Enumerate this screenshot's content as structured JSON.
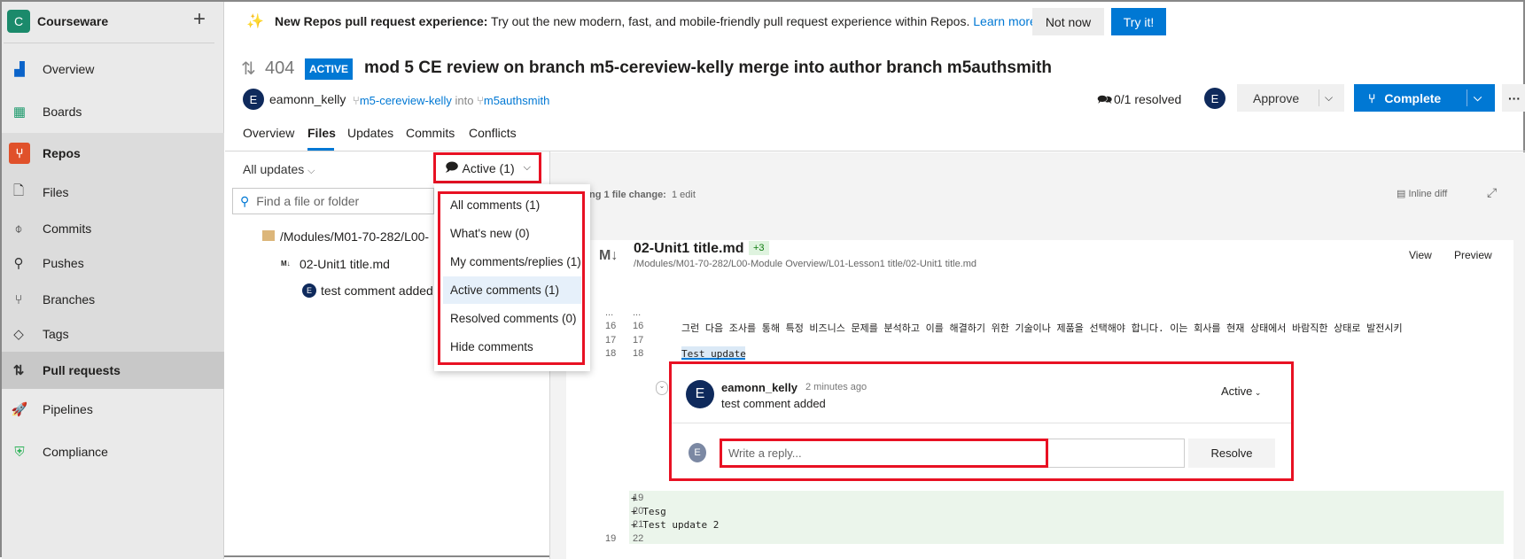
{
  "sidebar": {
    "org_initial": "C",
    "org": "Courseware",
    "add": "+",
    "items": [
      {
        "label": "Overview",
        "icon": "overview-icon"
      },
      {
        "label": "Boards",
        "icon": "boards-icon"
      },
      {
        "label": "Repos",
        "icon": "repos-icon"
      },
      {
        "label": "Files",
        "icon": "file-code-icon"
      },
      {
        "label": "Commits",
        "icon": "commit-icon"
      },
      {
        "label": "Pushes",
        "icon": "push-icon"
      },
      {
        "label": "Branches",
        "icon": "branch-icon"
      },
      {
        "label": "Tags",
        "icon": "tag-icon"
      },
      {
        "label": "Pull requests",
        "icon": "pull-request-icon"
      },
      {
        "label": "Pipelines",
        "icon": "pipelines-icon"
      },
      {
        "label": "Compliance",
        "icon": "compliance-icon"
      }
    ],
    "selected": "Pull requests"
  },
  "banner": {
    "bold": "New Repos pull request experience:",
    "text": "Try out the new modern, fast, and mobile-friendly pull request experience within Repos.",
    "link": "Learn more",
    "not_now": "Not now",
    "try": "Try it!"
  },
  "pr": {
    "id": "404",
    "status": "ACTIVE",
    "title": "mod 5 CE review on branch m5-cereview-kelly merge into author branch m5authsmith",
    "author_initial": "E",
    "author": "eamonn_kelly",
    "source": "m5-cereview-kelly",
    "into": "into",
    "target": "m5authsmith",
    "resolved": "0/1 resolved",
    "reviewer_initial": "E",
    "approve": "Approve",
    "complete": "Complete",
    "more": "···"
  },
  "tabs": [
    "Overview",
    "Files",
    "Updates",
    "Commits",
    "Conflicts"
  ],
  "active_tab": "Files",
  "files": {
    "updates": "All updates",
    "filter": "Active (1)",
    "search_placeholder": "Find a file or folder",
    "folder": "/Modules/M01-70-282/L00-",
    "file": "02-Unit1 title.md",
    "comment": "test comment added",
    "comment_initial": "E",
    "menu": [
      "All comments (1)",
      "What's new (0)",
      "My comments/replies (1)",
      "Active comments (1)",
      "Resolved comments (0)",
      "Hide comments"
    ],
    "menu_selected": "Active comments (1)"
  },
  "diff": {
    "summary_label": "ing 1 file change:",
    "summary_value": "1 edit",
    "inline": "Inline diff",
    "file_icon": "M↓",
    "file_name": "02-Unit1 title.md",
    "badge": "+3",
    "path": "/Modules/M01-70-282/L00-Module Overview/L01-Lesson1 title/02-Unit1 title.md",
    "view": "View",
    "preview": "Preview",
    "lines": [
      {
        "l": "...",
        "r": "...",
        "t": ""
      },
      {
        "l": "16",
        "r": "16",
        "t": "그런 다음 조사를 통해 특정 비즈니스 문제를 분석하고 이를 해결하기 위한 기술이나 제품을 선택해야 합니다. 이는 회사를 현재 상태에서 바람직한 상태로 발전시키"
      },
      {
        "l": "17",
        "r": "17",
        "t": ""
      },
      {
        "l": "18",
        "r": "18",
        "t": "Test update"
      }
    ],
    "added": [
      {
        "l": "",
        "r": "19",
        "t": "+"
      },
      {
        "l": "",
        "r": "20",
        "t": "+ Tesg"
      },
      {
        "l": "",
        "r": "21",
        "t": "+ Test update 2"
      }
    ],
    "last": {
      "l": "19",
      "r": "22",
      "t": ""
    }
  },
  "thread": {
    "initial": "E",
    "author": "eamonn_kelly",
    "time": "2 minutes ago",
    "text": "test comment added",
    "status": "Active",
    "reply_placeholder": "Write a reply...",
    "resolve": "Resolve"
  },
  "colors": {
    "accent": "#0078d4",
    "highlight": "#e81123",
    "added_bg": "#ebf5eb"
  }
}
